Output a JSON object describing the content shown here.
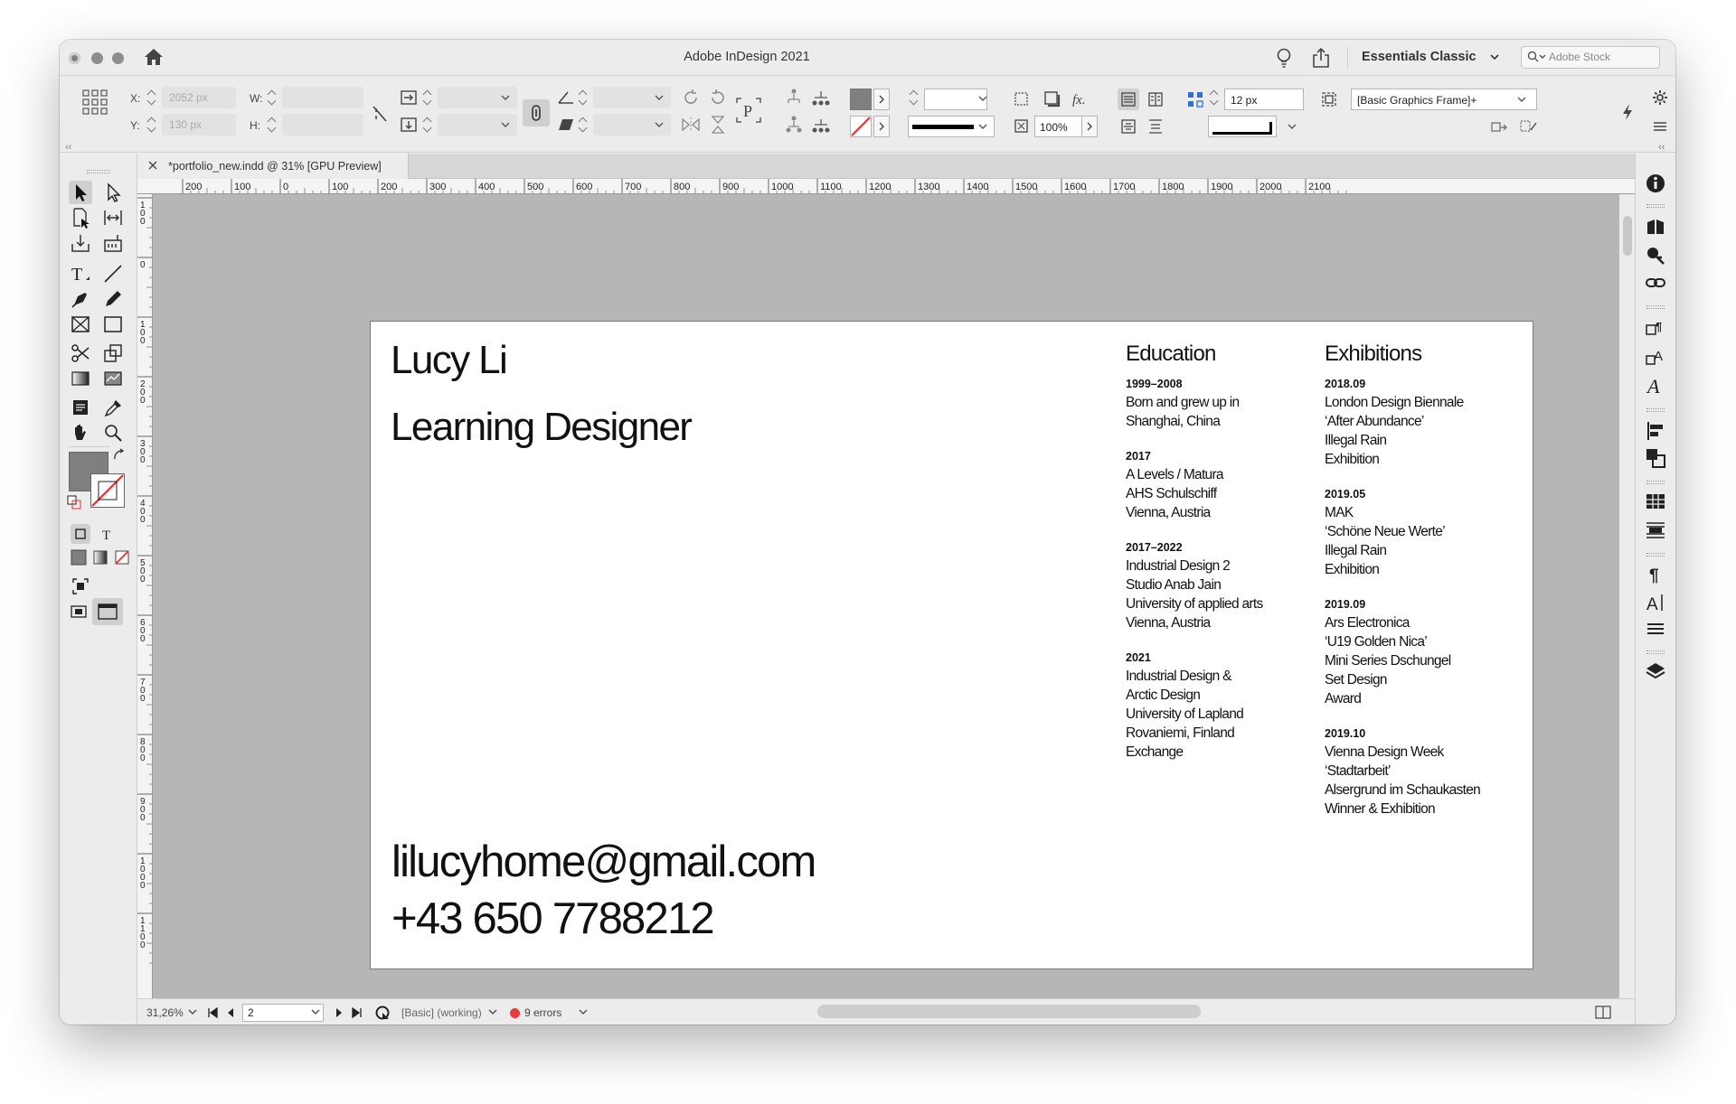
{
  "titlebar": {
    "app_title": "Adobe InDesign 2021",
    "workspace": "Essentials Classic",
    "stock_placeholder": "Adobe Stock"
  },
  "control_panel": {
    "x_label": "X:",
    "y_label": "Y:",
    "w_label": "W:",
    "h_label": "H:",
    "x_value": "2052 px",
    "y_value": "130 px",
    "opacity": "100%",
    "spacing": "12 px",
    "object_style": "[Basic Graphics Frame]+"
  },
  "tab": {
    "label": "*portfolio_new.indd @ 31% [GPU Preview]"
  },
  "rulers": {
    "h_ticks": [
      "200",
      "100",
      "0",
      "100",
      "200",
      "300",
      "400",
      "500",
      "600",
      "700",
      "800",
      "900",
      "1000",
      "1100",
      "1200",
      "1300",
      "1400",
      "1500",
      "1600",
      "1700",
      "1800",
      "1900",
      "2000",
      "2100"
    ],
    "v_ticks": [
      "1 0 0",
      "0",
      "1 0 0",
      "2 0 0",
      "3 0 0",
      "4 0 0",
      "5 0 0",
      "6 0 0",
      "7 0 0",
      "8 0 0",
      "9 0 0",
      "1 0 0 0",
      "1 1 0 0"
    ]
  },
  "document": {
    "name": "Lucy Li",
    "role": "Learning Designer",
    "email": "lilucyhome@gmail.com",
    "phone": "+43 650 7788212",
    "education": {
      "title": "Education",
      "entries": [
        {
          "date": "1999–2008",
          "lines": [
            "Born and grew up in",
            "Shanghai, China"
          ]
        },
        {
          "date": "2017",
          "lines": [
            "A Levels / Matura",
            "AHS Schulschiff",
            "Vienna, Austria"
          ]
        },
        {
          "date": "2017–2022",
          "lines": [
            "Industrial Design 2",
            "Studio Anab Jain",
            "University of applied arts",
            "Vienna, Austria"
          ]
        },
        {
          "date": "2021",
          "lines": [
            "Industrial Design &",
            "Arctic Design",
            "University of Lapland",
            "Rovaniemi, Finland",
            "Exchange"
          ]
        }
      ]
    },
    "exhibitions": {
      "title": "Exhibitions",
      "entries": [
        {
          "date": "2018.09",
          "lines": [
            "London Design Biennale",
            "‘After Abundance’",
            "Illegal Rain",
            "Exhibition"
          ]
        },
        {
          "date": "2019.05",
          "lines": [
            "MAK",
            "‘Schöne Neue Werte’",
            "Illegal Rain",
            "Exhibition"
          ]
        },
        {
          "date": "2019.09",
          "lines": [
            "Ars Electronica",
            "‘U19 Golden Nica’",
            "Mini Series Dschungel",
            "Set Design",
            "Award"
          ]
        },
        {
          "date": "2019.10",
          "lines": [
            "Vienna Design Week",
            "‘Stadtarbeit’",
            "Alsergrund im Schaukasten",
            "Winner & Exhibition"
          ]
        }
      ]
    }
  },
  "status_bar": {
    "zoom": "31,26%",
    "page_number": "2",
    "preflight_profile": "[Basic] (working)",
    "errors": "9 errors"
  }
}
